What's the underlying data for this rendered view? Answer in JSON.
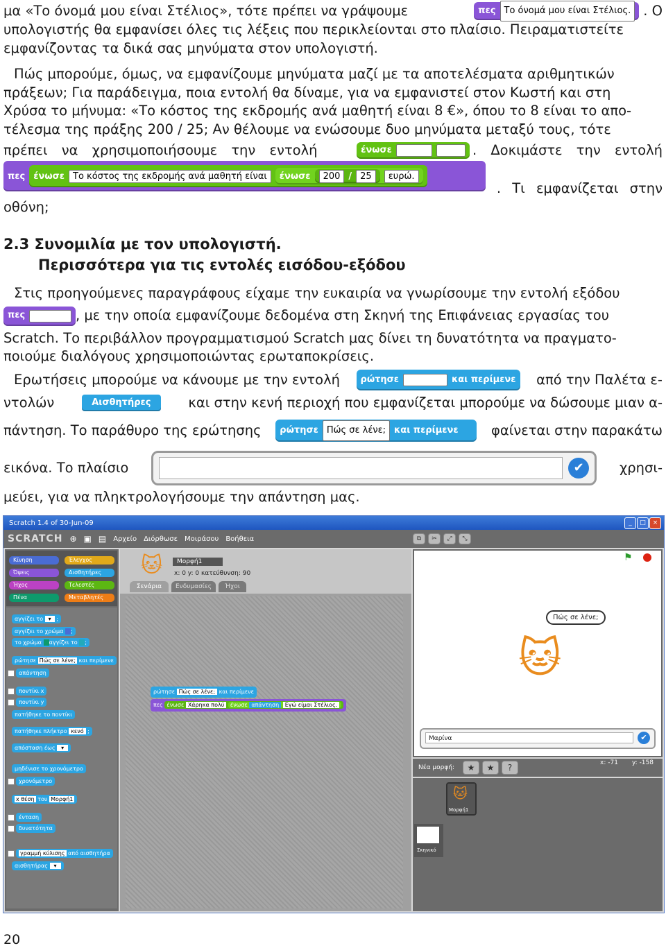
{
  "p1": {
    "l1a": "μα «Το όνομά μου είναι Στέλιος», τότε πρέπει να γράψουμε",
    "l1b": ". Ο",
    "l2": "υπολογιστής θα εμφανίσει όλες τις λέξεις που περικλείονται στο πλαίσιο. Πειραματιστείτε",
    "l3": "εμφανίζοντας τα δικά σας μηνύματα στον υπολογιστή."
  },
  "p2": {
    "l1": "Πώς μπορούμε, όμως, να εμφανίζουμε μηνύματα μαζί με τα αποτελέσματα αριθμητικών",
    "l2": "πράξεων; Για παράδειγμα, ποια εντολή θα δίναμε, για να εμφανιστεί στον Κωστή και στη",
    "l3": "Χρύσα το μήνυμα: «Το κόστος της εκδρομής ανά μαθητή είναι 8 €», όπου το 8 είναι το απο-",
    "l4": "τέλεσμα της πράξης 200 / 25; Αν θέλουμε να ενώσουμε δυο μηνύματα μεταξύ τους, τότε",
    "l5a": "πρέπει να χρησιμοποιήσουμε την εντολή",
    "l5b": ". Δοκιμάστε την εντολή",
    "l6": ". Τι εμφανίζεται στην",
    "l7": "οθόνη;"
  },
  "blocks": {
    "say": "πες",
    "say_text": "Το όνομά μου είναι Στέλιος.",
    "join": "ένωσε",
    "join_text": "Το κόστος της εκδρομής ανά μαθητή είναι",
    "n200": "200",
    "slash": "/",
    "n25": "25",
    "euro": "ευρώ.",
    "ask": "ρώτησε",
    "wait": "και περίμενε",
    "ask_text": "Πώς σε λένε;",
    "sensing": "Αισθητήρες"
  },
  "heading": {
    "h1": "2.3 Συνομιλία με τον υπολογιστή.",
    "h2": "Περισσότερα για τις εντολές εισόδου-εξόδου"
  },
  "p3": {
    "l1": "Στις προηγούμενες παραγράφους είχαμε την ευκαιρία να γνωρίσουμε την εντολή εξόδου",
    "l2": ", με την οποία εμφανίζουμε δεδομένα στη Σκηνή της Επιφάνειας εργασίας του",
    "l3": "Scratch. Το περιβάλλον προγραμματισμού Scratch μας δίνει τη δυνατότητα να πραγματο-",
    "l4": "ποιούμε διαλόγους χρησιμοποιώντας ερωταποκρίσεις."
  },
  "p4": {
    "l1a": "Ερωτήσεις μπορούμε να κάνουμε με την εντολή",
    "l1b": "από την Παλέτα ε-",
    "l2a": "ντολών",
    "l2b": "και στην κενή περιοχή που εμφανίζεται μπορούμε να δώσουμε μιαν α-",
    "l3a": "πάντηση. Το παράθυρο της ερώτησης",
    "l3b": "φαίνεται στην παρακάτω",
    "l4a": "εικόνα. Το πλαίσιο",
    "l4b": "χρησι-",
    "l5": "μεύει, για να πληκτρολογήσουμε την απάντηση μας."
  },
  "screenshot": {
    "title": "Scratch 1.4 of 30-Jun-09",
    "logo": "SCRATCH",
    "menu": [
      "Αρχείο",
      "Διόρθωσε",
      "Μοιράσου",
      "Βοήθεια"
    ],
    "categories": [
      "Κίνηση",
      "Έλεγχος",
      "Όψεις",
      "Αισθητήρες",
      "Ήχος",
      "Τελεστές",
      "Πένα",
      "Μεταβλητές"
    ],
    "sprite_name": "Μορφή1",
    "sprite_coords": "x: 0    y: 0    κατεύθυνση: 90",
    "tabs": [
      "Σενάρια",
      "Ενδυμασίες",
      "Ήχοι"
    ],
    "palette_blocks": [
      "αγγίζει το",
      ";",
      "αγγίζει το χρώμα",
      ";",
      "το χρώμα",
      "αγγίζει το",
      ";",
      "ρώτησε",
      "Πώς σε λένε;",
      "και περίμενε",
      "απάντηση",
      "ποντίκι x",
      "ποντίκι y",
      "πατήθηκε το ποντίκι",
      "πατήθηκε πλήκτρο",
      "κενό",
      ";",
      "απόσταση έως",
      "μηδένισε το χρονόμετρο",
      "χρονόμετρο",
      "x θέση",
      "του",
      "Μορφή1",
      "ένταση",
      "δυνατότητα",
      "γραμμή κύλισης",
      "από αισθητήρα",
      "αισθητήρας"
    ],
    "script_ask": "ρώτησε",
    "script_ask_text": "Πώς σε λένε;",
    "script_wait": "και περίμενε",
    "script_say": "πες",
    "script_say_text": "Χάρηκα πολύ",
    "script_join1": "ένωσε",
    "script_answer": "απάντηση",
    "script_join2": "ένωσε",
    "script_text2": "Εγώ είμαι Στέλιος.",
    "bubble": "Πώς σε λένε;",
    "answer_value": "Μαρίνα",
    "new_sprite": "Νέα μορφή:",
    "x_readout": "x: -71",
    "y_readout": "y: -158",
    "thumb_label": "Μορφή1",
    "stage_label": "Σκηνικό"
  },
  "page_number": "20"
}
